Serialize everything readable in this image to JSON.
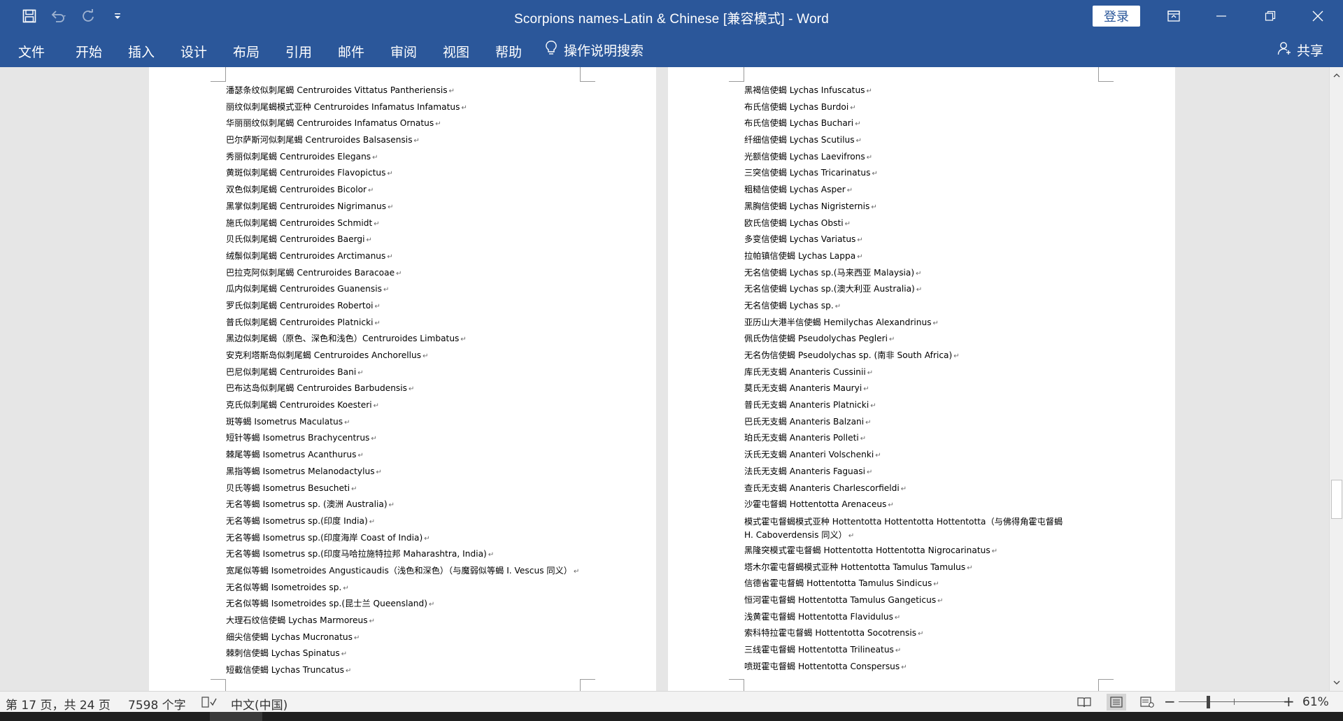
{
  "titlebar": {
    "doc_title": "Scorpions names-Latin & Chinese [兼容模式]  -  Word",
    "login_label": "登录",
    "bg_color": "#2b579a",
    "icons": [
      "save-icon",
      "undo-icon",
      "redo-icon",
      "customize-qat-icon",
      "ribbon-display-icon",
      "minimize-icon",
      "restore-icon",
      "close-icon"
    ]
  },
  "ribbon": {
    "tabs": [
      "文件",
      "开始",
      "插入",
      "设计",
      "布局",
      "引用",
      "邮件",
      "审阅",
      "视图",
      "帮助"
    ],
    "tellme_label": "操作说明搜索",
    "share_label": "共享"
  },
  "left_page": {
    "lines": [
      "潘瑟条纹似刺尾蝎 Centruroides Vittatus Pantheriensis",
      "丽纹似刺尾蝎模式亚种 Centruroides Infamatus Infamatus",
      "华丽丽纹似刺尾蝎 Centruroides Infamatus Ornatus",
      "巴尔萨斯河似刺尾蝎 Centruroides Balsasensis",
      "秀丽似刺尾蝎 Centruroides Elegans",
      "黄斑似刺尾蝎 Centruroides Flavopictus",
      "双色似刺尾蝎 Centruroides Bicolor",
      "黑掌似刺尾蝎 Centruroides Nigrimanus",
      "施氏似刺尾蝎 Centruroides Schmidt",
      "贝氏似刺尾蝎 Centruroides Baergi",
      "绒鬃似刺尾蝎 Centruroides Arctimanus",
      "巴拉克阿似刺尾蝎 Centruroides Baracoae",
      "瓜内似刺尾蝎 Centruroides Guanensis",
      "罗氏似刺尾蝎 Centruroides Robertoi",
      "普氏似刺尾蝎 Centruroides Platnicki",
      "黑边似刺尾蝎（原色、深色和浅色）Centruroides Limbatus",
      "安克利塔斯岛似刺尾蝎 Centruroides Anchorellus",
      "巴尼似刺尾蝎 Centruroides Bani",
      "巴布达岛似刺尾蝎 Centruroides Barbudensis",
      "克氏似刺尾蝎 Centruroides Koesteri",
      "斑等蝎 Isometrus Maculatus",
      "短针等蝎 Isometrus Brachycentrus",
      "棘尾等蝎 Isometrus Acanthurus",
      "黑指等蝎 Isometrus Melanodactylus",
      "贝氏等蝎 Isometrus Besucheti",
      "无名等蝎 Isometrus sp. (澳洲 Australia)",
      "无名等蝎 Isometrus sp.(印度 India)",
      "无名等蝎 Isometrus sp.(印度海岸 Coast of India)",
      "无名等蝎 Isometrus sp.(印度马哈拉施特拉邦 Maharashtra, India)",
      "宽尾似等蝎 Isometroides Angusticaudis（浅色和深色）（与魔弱似等蝎 I. Vescus 同义）",
      "无名似等蝎 Isometroides sp.",
      "无名似等蝎 Isometroides sp.(昆士兰 Queensland)",
      "大理石纹信使蝎 Lychas Marmoreus",
      "细尖信使蝎 Lychas Mucronatus",
      "棘刺信使蝎 Lychas Spinatus",
      "短截信使蝎 Lychas Truncatus"
    ]
  },
  "right_page": {
    "lines": [
      "黑褐信使蝎 Lychas Infuscatus",
      "布氏信使蝎 Lychas Burdoi",
      "布氏信使蝎 Lychas Buchari",
      "纤细信使蝎 Lychas Scutilus",
      "光额信使蝎 Lychas Laevifrons",
      "三突信使蝎 Lychas Tricarinatus",
      "粗糙信使蝎 Lychas Asper",
      "黑胸信使蝎 Lychas Nigristernis",
      "欧氏信使蝎 Lychas Obsti",
      "多变信使蝎 Lychas Variatus",
      "拉帕镇信使蝎 Lychas Lappa",
      "无名信使蝎 Lychas sp.(马来西亚 Malaysia)",
      "无名信使蝎 Lychas sp.(澳大利亚 Australia)",
      "无名信使蝎 Lychas sp.",
      "亚历山大港半信使蝎 Hemilychas Alexandrinus",
      "佩氏伪信使蝎 Pseudolychas Pegleri",
      "无名伪信使蝎 Pseudolychas sp. (南非 South Africa)",
      "库氏无支蝎 Ananteris Cussinii",
      "莫氏无支蝎 Ananteris Mauryi",
      "普氏无支蝎 Ananteris Platnicki",
      "巴氏无支蝎 Ananteris Balzani",
      "珀氏无支蝎 Ananteris Polleti",
      "沃氏无支蝎 Ananteri Volschenki",
      "法氏无支蝎 Ananteris Faguasi",
      "查氏无支蝎 Ananteris Charlescorfieldi",
      "沙霍屯督蝎 Hottentotta Arenaceus",
      "模式霍屯督蝎模式亚种 Hottentotta Hottentotta Hottentotta（与佛得角霍屯督蝎 H. Caboverdensis 同义）",
      "黑隆突模式霍屯督蝎 Hottentotta Hottentotta Nigrocarinatus",
      "塔木尔霍屯督蝎模式亚种 Hottentotta Tamulus Tamulus",
      "信德省霍屯督蝎 Hottentotta Tamulus Sindicus",
      "恒河霍屯督蝎 Hottentotta Tamulus Gangeticus",
      "浅黄霍屯督蝎 Hottentotta Flavidulus",
      "索科特拉霍屯督蝎 Hottentotta Socotrensis",
      "三线霍屯督蝎 Hottentotta Trilineatus",
      "喷斑霍屯督蝎 Hottentotta Conspersus"
    ]
  },
  "paragraph_mark": "↵",
  "statusbar": {
    "page_info": "第 17 页，共 24 页",
    "word_count": "7598 个字",
    "language": "中文(中国)",
    "zoom_label": "61%",
    "zoom_minus": "−",
    "zoom_plus": "+"
  }
}
